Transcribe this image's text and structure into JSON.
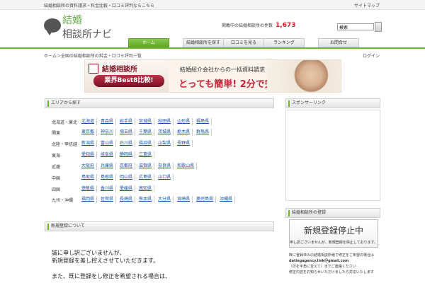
{
  "topbar": {
    "tagline": "結婚相談所の資料請求・料金比較・口コミ評判ならこちら",
    "sitemap": "サイトマップ"
  },
  "logo": {
    "line1": "結婚",
    "line2": "相談所ナビ"
  },
  "counter": {
    "label": "掲載中の結婚相談所の件数",
    "value": "1,673"
  },
  "search": {
    "value": "検索",
    "button_icon": "search-button"
  },
  "nav": {
    "tabs": [
      {
        "label": "ホーム",
        "active": true
      },
      {
        "label": "結婚相談所を探す",
        "active": false
      },
      {
        "label": "口コミを見る",
        "active": false
      },
      {
        "label": "ランキング",
        "active": false
      },
      {
        "label": "お問合せ",
        "active": false
      }
    ]
  },
  "breadcrumb": {
    "left": "ホーム＞全国の結婚相談所の料金・口コミ評判一覧",
    "right": "ログイン"
  },
  "banner": {
    "badge_text": "比較",
    "title": "結婚相談所",
    "pill": "業界Best8比較!",
    "subtitle": "結婚紹介会社からの一括資料請求",
    "cta": "とっても簡単! 2分で完了。"
  },
  "areas_panel": {
    "title": "エリアから探す",
    "rows": [
      {
        "region": "北海道・東北",
        "links": [
          "北海道",
          "青森県",
          "岩手県",
          "宮城県",
          "秋田県",
          "山形県",
          "福島県"
        ]
      },
      {
        "region": "関東",
        "links": [
          "東京都",
          "神奈川",
          "埼玉県",
          "千葉県",
          "茨城県",
          "栃木県",
          "群馬県"
        ]
      },
      {
        "region": "北陸・甲信越",
        "links": [
          "新潟県",
          "富山県",
          "石川県",
          "福井県",
          "山梨県",
          "長野県"
        ]
      },
      {
        "region": "東海",
        "links": [
          "愛知県",
          "岐阜県",
          "静岡県",
          "三重県"
        ]
      },
      {
        "region": "近畿",
        "links": [
          "大阪府",
          "兵庫県",
          "京都府",
          "滋賀県",
          "奈良県",
          "和歌山県"
        ]
      },
      {
        "region": "中国",
        "links": [
          "鳥取県",
          "島根県",
          "岡山県",
          "広島県",
          "山口県"
        ]
      },
      {
        "region": "四国",
        "links": [
          "徳島県",
          "香川県",
          "愛媛県",
          "高知県"
        ]
      },
      {
        "region": "九州・沖縄",
        "links": [
          "福岡県",
          "佐賀県",
          "長崎県",
          "熊本県",
          "大分県",
          "宮崎県",
          "鹿児島県",
          "沖縄県"
        ]
      }
    ]
  },
  "registration_panel": {
    "title": "新規登録について",
    "message_lines": [
      "誠に申し訳ございませんが、",
      "新規登録を差し控えさせていただきます。",
      "",
      "また、既に登録をし修正を希望される場合は、"
    ]
  },
  "sidebar": {
    "ad_panel_title": "スポンサーリンク",
    "register_panel_title": "結婚相談所の登録",
    "notice_big": "新規登録停止中",
    "notice_small": "申し訳ございませんが、新規登録を停止しております。",
    "contact_lines": [
      "既に登録済みの結婚相談所様で修正をご希望の場合は",
      "datingagency.link＠gmail.com",
      "（＠を半角に変えて）までご連絡ください",
      "修正内容をお知らせいただけましたら対応いたします"
    ]
  }
}
